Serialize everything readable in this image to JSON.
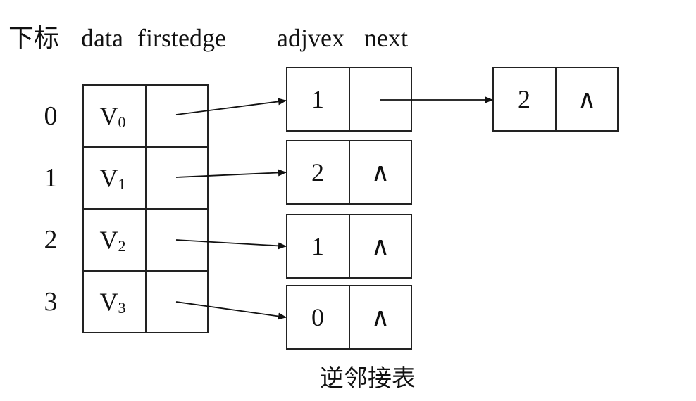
{
  "headers": {
    "subscript": "下标",
    "data": "data",
    "firstedge": "firstedge",
    "adjvex": "adjvex",
    "next": "next"
  },
  "vertices": [
    {
      "index": "0",
      "data": "V",
      "sub": "0"
    },
    {
      "index": "1",
      "data": "V",
      "sub": "1"
    },
    {
      "index": "2",
      "data": "V",
      "sub": "2"
    },
    {
      "index": "3",
      "data": "V",
      "sub": "3"
    }
  ],
  "edge_nodes": [
    {
      "adjvex": "1",
      "next": ""
    },
    {
      "adjvex": "2",
      "next": "∧"
    },
    {
      "adjvex": "1",
      "next": "∧"
    },
    {
      "adjvex": "0",
      "next": "∧"
    }
  ],
  "extra_node": {
    "adjvex": "2",
    "next": "∧"
  },
  "caption": "逆邻接表"
}
